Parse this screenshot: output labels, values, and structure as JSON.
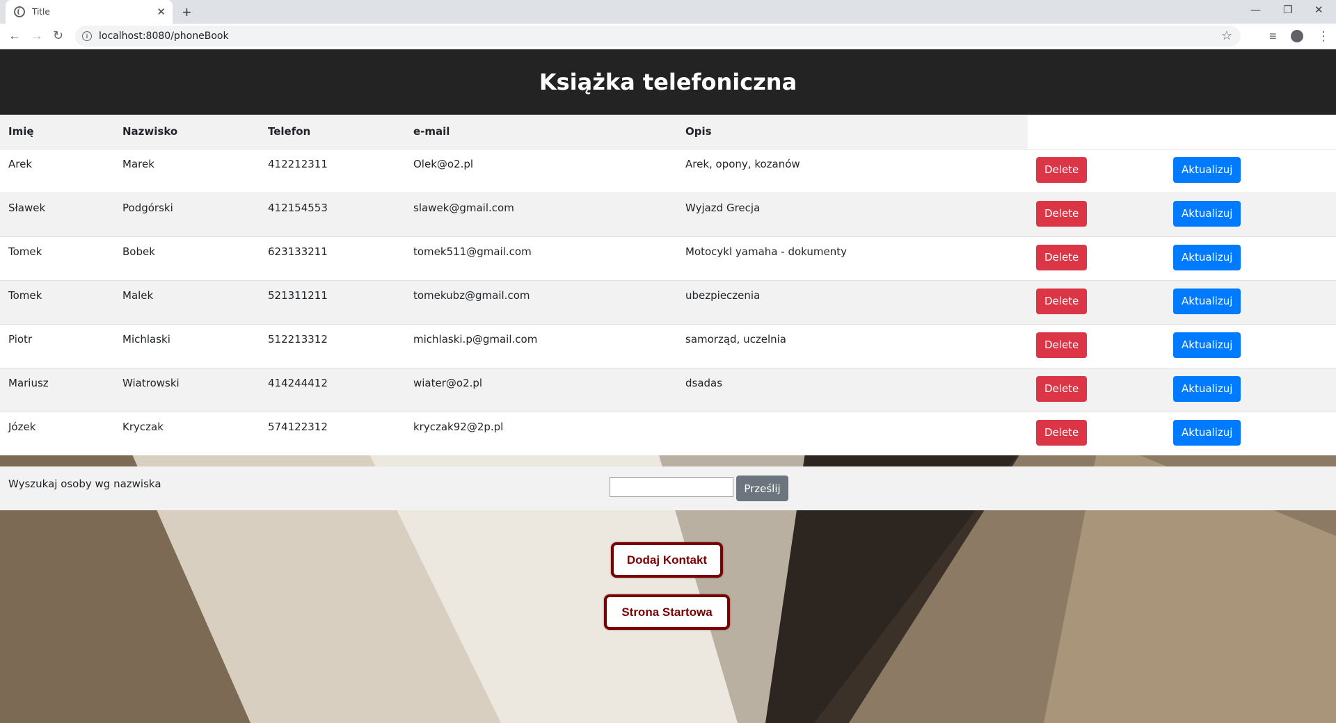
{
  "browser": {
    "tab_title": "Title",
    "url": "localhost:8080/phoneBook"
  },
  "header": {
    "title": "Książka telefoniczna"
  },
  "table": {
    "columns": [
      "Imię",
      "Nazwisko",
      "Telefon",
      "e-mail",
      "Opis"
    ],
    "rows": [
      {
        "first": "Arek",
        "last": "Marek",
        "phone": "412212311",
        "email": "Olek@o2.pl",
        "desc": "Arek, opony, kozanów"
      },
      {
        "first": "Sławek",
        "last": "Podgórski",
        "phone": "412154553",
        "email": "slawek@gmail.com",
        "desc": "Wyjazd Grecja"
      },
      {
        "first": "Tomek",
        "last": "Bobek",
        "phone": "623133211",
        "email": "tomek511@gmail.com",
        "desc": "Motocykl yamaha - dokumenty"
      },
      {
        "first": "Tomek",
        "last": "Malek",
        "phone": "521311211",
        "email": "tomekubz@gmail.com",
        "desc": "ubezpieczenia"
      },
      {
        "first": "Piotr",
        "last": "Michlaski",
        "phone": "512213312",
        "email": "michlaski.p@gmail.com",
        "desc": "samorząd, uczelnia"
      },
      {
        "first": "Mariusz",
        "last": "Wiatrowski",
        "phone": "414244412",
        "email": "wiater@o2.pl",
        "desc": "dsadas"
      },
      {
        "first": "Józek",
        "last": "Kryczak",
        "phone": "574122312",
        "email": "kryczak92@2p.pl",
        "desc": ""
      }
    ],
    "delete_label": "Delete",
    "update_label": "Aktualizuj",
    "colors": {
      "delete": "#dc3545",
      "update": "#007bff"
    }
  },
  "search": {
    "label": "Wyszukaj osoby wg nazwiska",
    "value": "",
    "submit_label": "Prześlij"
  },
  "actions": {
    "add_contact": "Dodaj Kontakt",
    "home_page": "Strona Startowa",
    "accent": "#7a0000"
  }
}
